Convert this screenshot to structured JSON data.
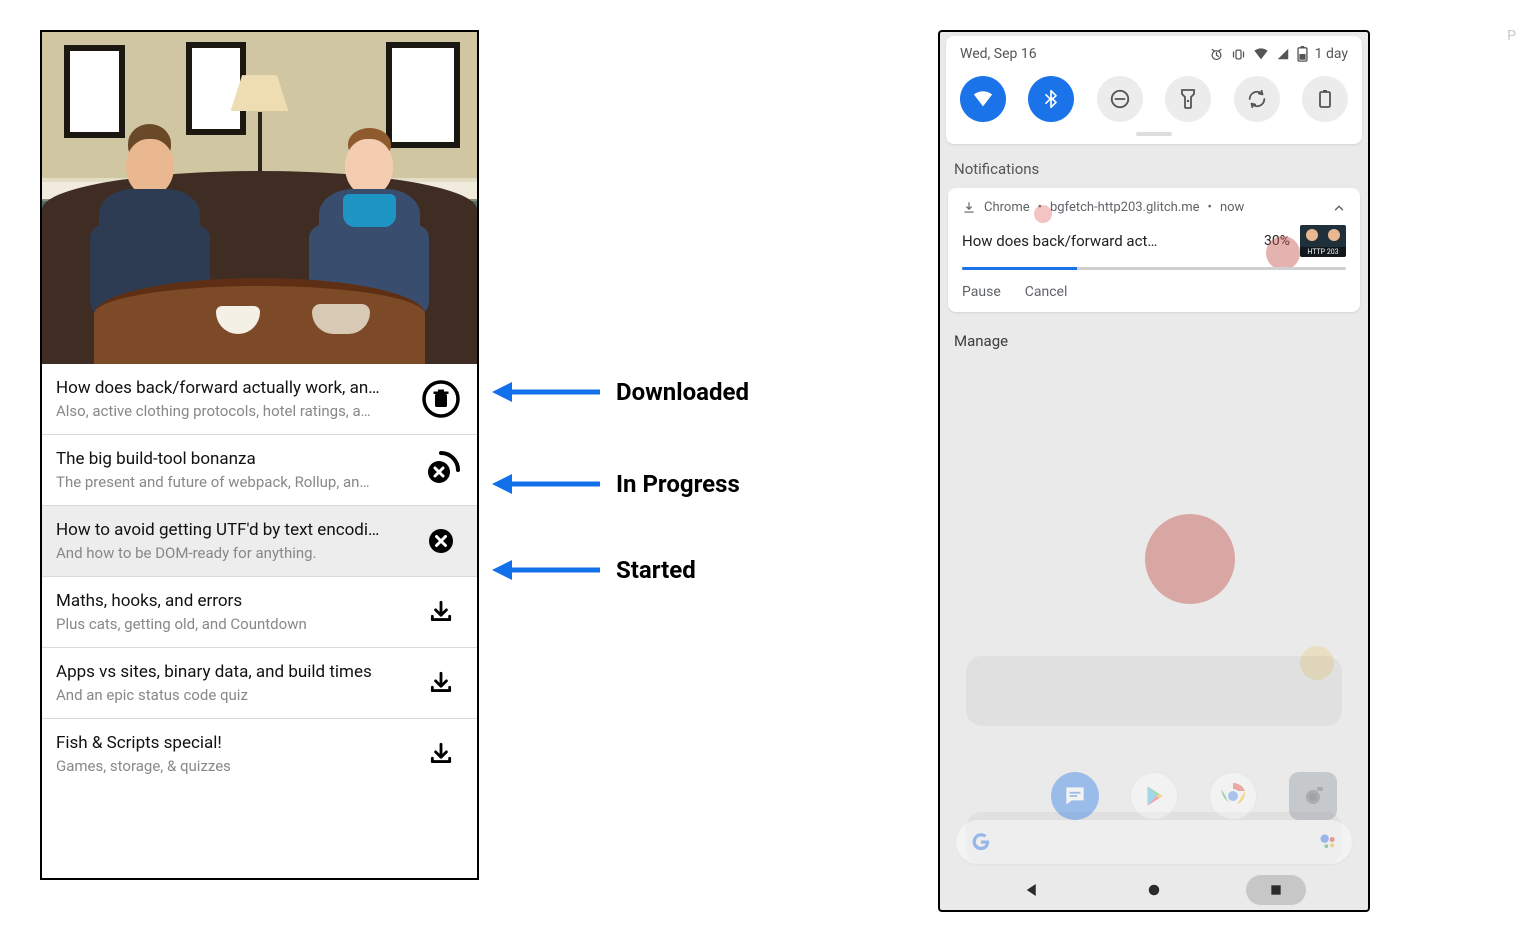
{
  "annotations": {
    "downloaded": "Downloaded",
    "in_progress": "In Progress",
    "started": "Started"
  },
  "episodes": [
    {
      "title": "How does back/forward actually work, an…",
      "subtitle": "Also, active clothing protocols, hotel ratings, a…",
      "state": "downloaded"
    },
    {
      "title": "The big build-tool bonanza",
      "subtitle": "The present and future of webpack, Rollup, an…",
      "state": "in_progress"
    },
    {
      "title": "How to avoid getting UTF'd by text encodi…",
      "subtitle": "And how to be DOM-ready for anything.",
      "state": "started",
      "selected": true
    },
    {
      "title": "Maths, hooks, and errors",
      "subtitle": "Plus cats, getting old, and Countdown",
      "state": "idle"
    },
    {
      "title": "Apps vs sites, binary data, and build times",
      "subtitle": "And an epic status code quiz",
      "state": "idle"
    },
    {
      "title": "Fish & Scripts special!",
      "subtitle": "Games, storage, & quizzes",
      "state": "idle"
    }
  ],
  "phone": {
    "date": "Wed, Sep 16",
    "battery_text": "1 day",
    "sections": {
      "notifications": "Notifications"
    },
    "notif": {
      "app": "Chrome",
      "source": "bgfetch-http203.glitch.me",
      "when": "now",
      "title": "How does back/forward act…",
      "percent_text": "30%",
      "percent_value": 30,
      "thumb_label": "HTTP 203",
      "actions": {
        "pause": "Pause",
        "cancel": "Cancel"
      }
    },
    "manage": "Manage"
  },
  "side_letter": "P"
}
